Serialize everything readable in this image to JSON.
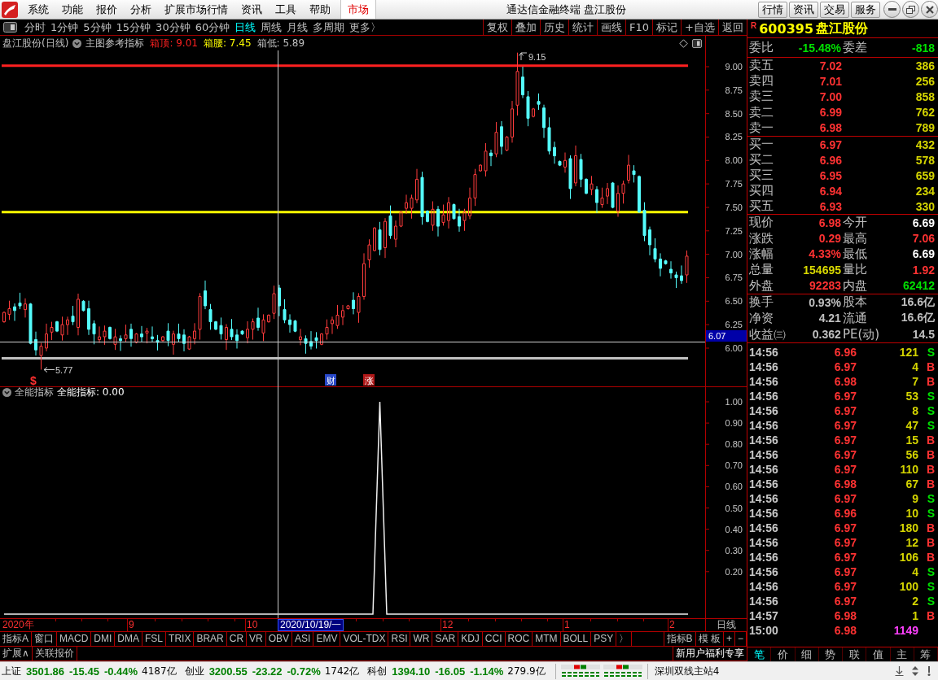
{
  "window": {
    "title": "通达信金融终端 盘江股份"
  },
  "menu_bar": {
    "items": [
      "系统",
      "功能",
      "报价",
      "分析",
      "扩展市场行情",
      "资讯",
      "工具",
      "帮助"
    ],
    "market_tab": "市场"
  },
  "header_buttons": [
    "行情",
    "资讯",
    "交易",
    "服务"
  ],
  "period_tabs": [
    {
      "label": "分时",
      "selected": false
    },
    {
      "label": "1分钟",
      "selected": false
    },
    {
      "label": "5分钟",
      "selected": false
    },
    {
      "label": "15分钟",
      "selected": false
    },
    {
      "label": "30分钟",
      "selected": false
    },
    {
      "label": "60分钟",
      "selected": false
    },
    {
      "label": "日线",
      "selected": true
    },
    {
      "label": "周线",
      "selected": false
    },
    {
      "label": "月线",
      "selected": false
    },
    {
      "label": "多周期",
      "selected": false
    },
    {
      "label": "更多〉",
      "selected": false
    }
  ],
  "chart_tools": [
    "复权",
    "叠加",
    "历史",
    "统计",
    "画线",
    "F10",
    "标记",
    "+自选",
    "返回"
  ],
  "main_chart": {
    "title": "盘江股份(日线)",
    "indicator": "主图参考指标",
    "readings": [
      {
        "label": "箱顶: 9.01",
        "color": "#ff2020"
      },
      {
        "label": "箱腰: 7.45",
        "color": "#ffff00"
      },
      {
        "label": "箱低: 5.89",
        "color": "#c0c0c0"
      }
    ],
    "price_axis": [
      "9.00",
      "8.75",
      "8.50",
      "8.25",
      "8.00",
      "7.75",
      "7.50",
      "7.25",
      "7.00",
      "6.75",
      "6.50",
      "6.25",
      "6.00"
    ],
    "cursor_price": "6.07",
    "high_marker": "9.15",
    "low_marker": "5.77",
    "event_marks": [
      {
        "label": "$",
        "kind": "plain",
        "color": "#ff3030"
      },
      {
        "label": "财",
        "kind": "boxed",
        "color": "#2848c8"
      },
      {
        "label": "涨",
        "kind": "boxed",
        "color": "#b01818"
      }
    ]
  },
  "indicator_panel": {
    "name": "全能指标",
    "reading": "全能指标: 0.00",
    "axis": [
      "1.00",
      "0.90",
      "0.80",
      "0.70",
      "0.60",
      "0.50",
      "0.40",
      "0.30",
      "0.20"
    ]
  },
  "date_axis": {
    "labels": [
      "2020年",
      "9",
      "10",
      "12",
      "1",
      "2"
    ],
    "cursor_date": "2020/10/19/一",
    "period": "日线"
  },
  "indicator_tabs": [
    "指标A",
    "窗口",
    "MACD",
    "DMI",
    "DMA",
    "FSL",
    "TRIX",
    "BRAR",
    "CR",
    "VR",
    "OBV",
    "ASI",
    "EMV",
    "VOL-TDX",
    "RSI",
    "WR",
    "SAR",
    "KDJ",
    "CCI",
    "ROC",
    "MTM",
    "BOLL",
    "PSY",
    "〉"
  ],
  "template_tabs": [
    "指标B",
    "模 板",
    "+",
    "−"
  ],
  "extra_tabs": [
    "扩展∧",
    "关联报价"
  ],
  "promo": "新用户福利专享",
  "quote_panel": {
    "flag": "R",
    "code": "600395",
    "name": "盘江股份",
    "order_ratio": [
      {
        "label": "委比",
        "value": "-15.48%",
        "color": "#00e000"
      },
      {
        "label": "委差",
        "value": "-818",
        "color": "#00e000"
      }
    ],
    "asks": [
      {
        "label": "卖五",
        "price": "7.02",
        "volume": "386"
      },
      {
        "label": "卖四",
        "price": "7.01",
        "volume": "256"
      },
      {
        "label": "卖三",
        "price": "7.00",
        "volume": "858"
      },
      {
        "label": "卖二",
        "price": "6.99",
        "volume": "762"
      },
      {
        "label": "卖一",
        "price": "6.98",
        "volume": "789"
      }
    ],
    "bids": [
      {
        "label": "买一",
        "price": "6.97",
        "volume": "432"
      },
      {
        "label": "买二",
        "price": "6.96",
        "volume": "578"
      },
      {
        "label": "买三",
        "price": "6.95",
        "volume": "659"
      },
      {
        "label": "买四",
        "price": "6.94",
        "volume": "234"
      },
      {
        "label": "买五",
        "price": "6.93",
        "volume": "330"
      }
    ],
    "stats": [
      {
        "label": "现价",
        "value": "6.98",
        "color": "#ff3232"
      },
      {
        "label": "今开",
        "value": "6.69",
        "color": "#ffffff"
      },
      {
        "label": "涨跌",
        "value": "0.29",
        "color": "#ff3232"
      },
      {
        "label": "最高",
        "value": "7.06",
        "color": "#ff3232"
      },
      {
        "label": "涨幅",
        "value": "4.33%",
        "color": "#ff3232"
      },
      {
        "label": "最低",
        "value": "6.69",
        "color": "#ffffff"
      },
      {
        "label": "总量",
        "value": "154695",
        "color": "#d8d800"
      },
      {
        "label": "量比",
        "value": "1.92",
        "color": "#ff3232"
      },
      {
        "label": "外盘",
        "value": "92283",
        "color": "#ff3232"
      },
      {
        "label": "内盘",
        "value": "62412",
        "color": "#00e000"
      }
    ],
    "fundamentals": [
      {
        "label": "换手",
        "value": "0.93%"
      },
      {
        "label": "股本",
        "value": "16.6亿"
      },
      {
        "label": "净资",
        "value": "4.21"
      },
      {
        "label": "流通",
        "value": "16.6亿"
      },
      {
        "label": "收益㈢",
        "value": "0.362"
      },
      {
        "label": "PE(动)",
        "value": "14.5"
      }
    ]
  },
  "ticks": [
    {
      "time": "14:56",
      "price": "6.96",
      "volume": "121",
      "side": "S",
      "color": "#00e000",
      "kind": "trade"
    },
    {
      "time": "14:56",
      "price": "6.97",
      "volume": "4",
      "side": "B",
      "color": "#ff3232",
      "kind": "trade"
    },
    {
      "time": "14:56",
      "price": "6.98",
      "volume": "7",
      "side": "B",
      "color": "#ff3232",
      "kind": "trade"
    },
    {
      "time": "14:56",
      "price": "6.97",
      "volume": "53",
      "side": "S",
      "color": "#00e000",
      "kind": "trade"
    },
    {
      "time": "14:56",
      "price": "6.97",
      "volume": "8",
      "side": "S",
      "color": "#00e000",
      "kind": "trade"
    },
    {
      "time": "14:56",
      "price": "6.97",
      "volume": "47",
      "side": "S",
      "color": "#00e000",
      "kind": "trade"
    },
    {
      "time": "14:56",
      "price": "6.97",
      "volume": "15",
      "side": "B",
      "color": "#ff3232",
      "kind": "trade"
    },
    {
      "time": "14:56",
      "price": "6.97",
      "volume": "56",
      "side": "B",
      "color": "#ff3232",
      "kind": "trade"
    },
    {
      "time": "14:56",
      "price": "6.97",
      "volume": "110",
      "side": "B",
      "color": "#ff3232",
      "kind": "trade"
    },
    {
      "time": "14:56",
      "price": "6.98",
      "volume": "67",
      "side": "B",
      "color": "#ff3232",
      "kind": "trade"
    },
    {
      "time": "14:56",
      "price": "6.97",
      "volume": "9",
      "side": "S",
      "color": "#00e000",
      "kind": "trade"
    },
    {
      "time": "14:56",
      "price": "6.96",
      "volume": "10",
      "side": "S",
      "color": "#00e000",
      "kind": "trade"
    },
    {
      "time": "14:56",
      "price": "6.97",
      "volume": "180",
      "side": "B",
      "color": "#ff3232",
      "kind": "trade"
    },
    {
      "time": "14:56",
      "price": "6.97",
      "volume": "12",
      "side": "B",
      "color": "#ff3232",
      "kind": "trade"
    },
    {
      "time": "14:56",
      "price": "6.97",
      "volume": "106",
      "side": "B",
      "color": "#ff3232",
      "kind": "trade"
    },
    {
      "time": "14:56",
      "price": "6.97",
      "volume": "4",
      "side": "S",
      "color": "#00e000",
      "kind": "trade"
    },
    {
      "time": "14:56",
      "price": "6.97",
      "volume": "100",
      "side": "S",
      "color": "#00e000",
      "kind": "trade"
    },
    {
      "time": "14:56",
      "price": "6.97",
      "volume": "2",
      "side": "S",
      "color": "#00e000",
      "kind": "trade"
    },
    {
      "time": "14:57",
      "price": "6.98",
      "volume": "1",
      "side": "B",
      "color": "#ff3232",
      "kind": "trade"
    },
    {
      "time": "15:00",
      "price": "6.98",
      "volume": "1149",
      "kind": "auction"
    }
  ],
  "panel_tabs": [
    {
      "label": "笔",
      "selected": true
    },
    {
      "label": "价",
      "selected": false
    },
    {
      "label": "细",
      "selected": false
    },
    {
      "label": "势",
      "selected": false
    },
    {
      "label": "联",
      "selected": false
    },
    {
      "label": "值",
      "selected": false
    },
    {
      "label": "主",
      "selected": false
    },
    {
      "label": "筹",
      "selected": false
    }
  ],
  "status_bar": {
    "indices": [
      {
        "name": "上证",
        "value": "3501.86",
        "change": "-15.45",
        "percent": "-0.44%",
        "turnover": "4187亿"
      },
      {
        "name": "创业",
        "value": "3200.55",
        "change": "-23.22",
        "percent": "-0.72%",
        "turnover": "1742亿"
      },
      {
        "name": "科创",
        "value": "1394.10",
        "change": "-16.05",
        "percent": "-1.14%",
        "turnover": "279.9亿"
      }
    ],
    "server": "深圳双线主站4"
  }
}
